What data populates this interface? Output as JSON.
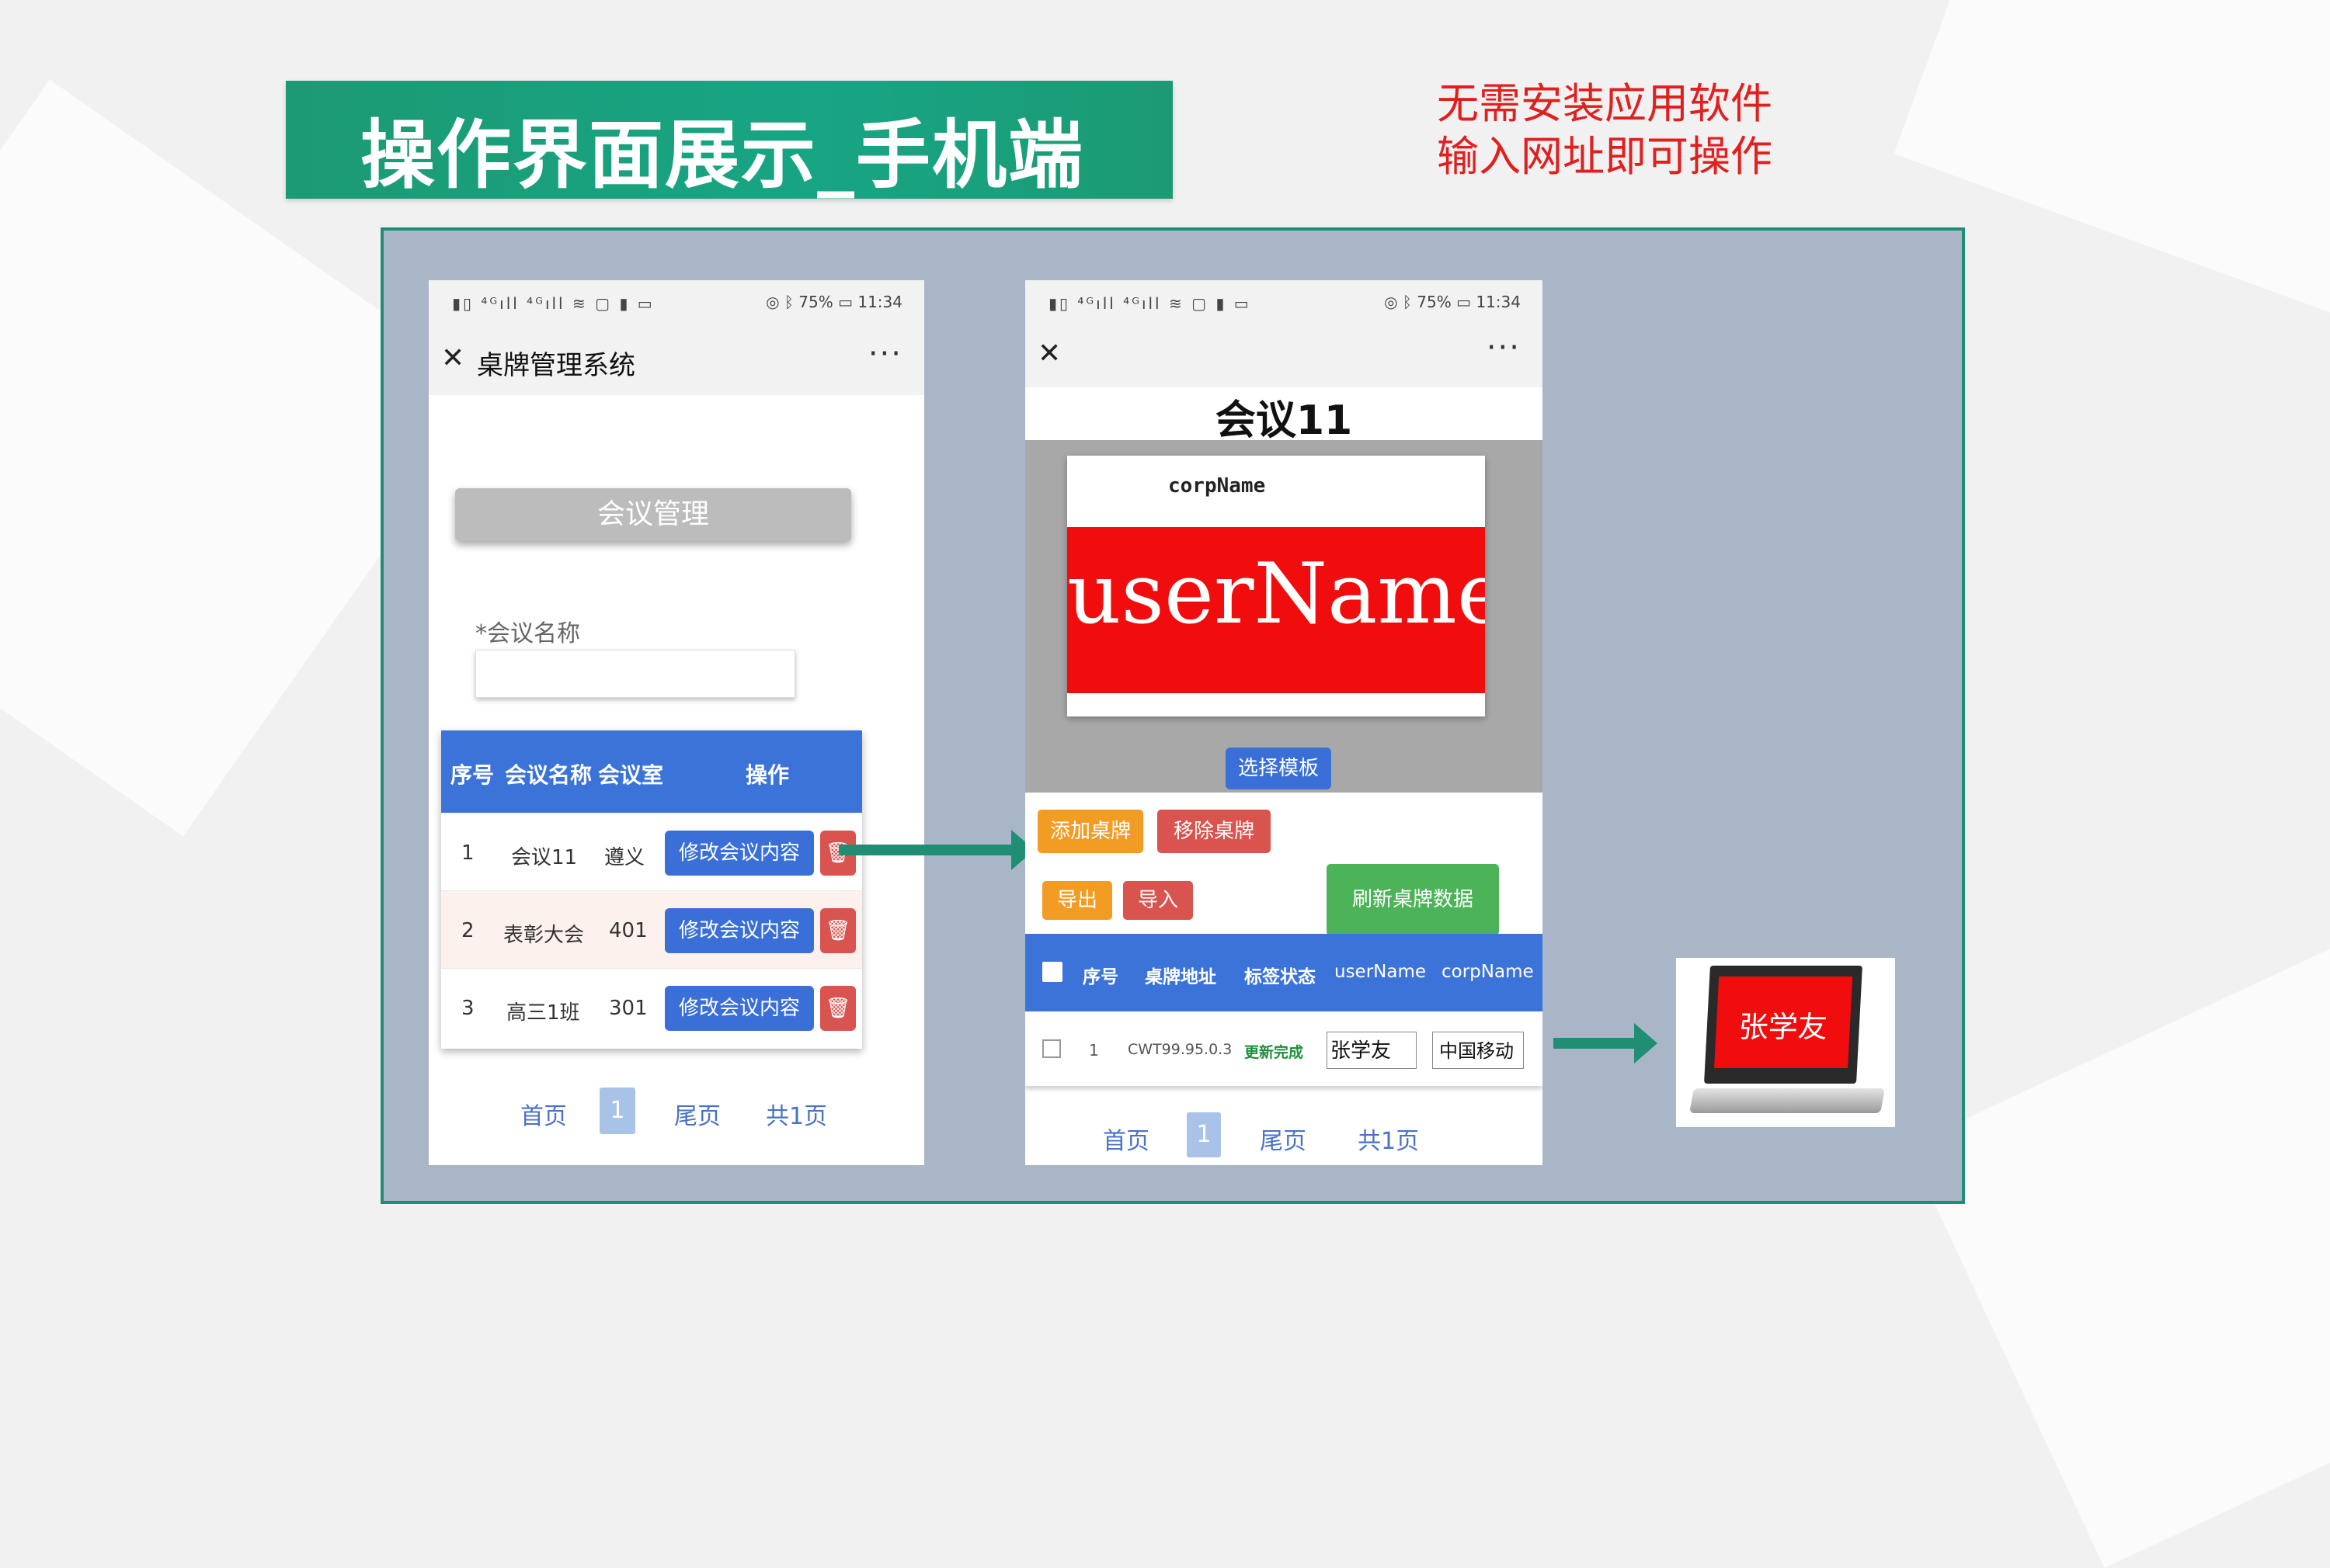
{
  "slide": {
    "title": "操作界面展示_手机端",
    "note_line1": "无需安装应用软件",
    "note_line2": "输入网址即可操作"
  },
  "phone1": {
    "status_left": "▮▯ ⁴ᴳıll ⁴ᴳıll ≋ ▢ ▮ ▭",
    "status_right": "◎ ᛒ 75% ▭ 11:34",
    "close_icon": "✕",
    "app_title": "桌牌管理系统",
    "more_icon": "···",
    "section_button": "会议管理",
    "field_label": "*会议名称",
    "field_value": "",
    "table": {
      "headers": [
        "序号",
        "会议名称",
        "会议室",
        "操作"
      ],
      "rows": [
        {
          "no": "1",
          "name": "会议11",
          "room": "遵义",
          "edit": "修改会议内容",
          "delete_icon": "🗑"
        },
        {
          "no": "2",
          "name": "表彰大会",
          "room": "401",
          "edit": "修改会议内容",
          "delete_icon": "🗑"
        },
        {
          "no": "3",
          "name": "高三1班",
          "room": "301",
          "edit": "修改会议内容",
          "delete_icon": "🗑"
        }
      ]
    },
    "pager": {
      "first": "首页",
      "current": "1",
      "last": "尾页",
      "total": "共1页"
    }
  },
  "phone2": {
    "status_left": "▮▯ ⁴ᴳıll ⁴ᴳıll ≋ ▢ ▮ ▭",
    "status_right": "◎ ᛒ 75% ▭ 11:34",
    "close_icon": "✕",
    "more_icon": "···",
    "meeting_title": "会议11",
    "preview": {
      "corp": "corpName",
      "user": "userName"
    },
    "template_button": "选择模板",
    "add_button": "添加桌牌",
    "remove_button": "移除桌牌",
    "export_button": "导出",
    "import_button": "导入",
    "refresh_button": "刷新桌牌数据",
    "table": {
      "headers": [
        "序号",
        "桌牌地址",
        "标签状态",
        "userName",
        "corpName"
      ],
      "row": {
        "no": "1",
        "address": "CWT99.95.0.3",
        "status": "更新完成",
        "user": "张学友",
        "corp": "中国移动"
      }
    },
    "pager": {
      "first": "首页",
      "current": "1",
      "last": "尾页",
      "total": "共1页"
    }
  },
  "device": {
    "name": "张学友"
  },
  "colors": {
    "accent_green": "#1f8e73",
    "table_blue": "#3c73d9",
    "red": "#e0201e"
  }
}
